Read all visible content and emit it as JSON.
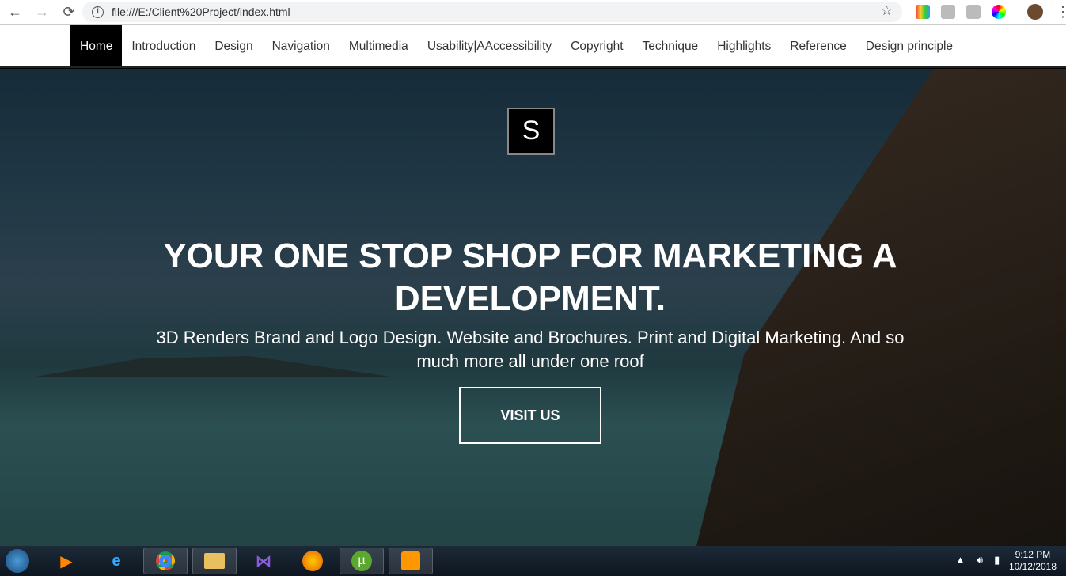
{
  "browser": {
    "url": "file:///E:/Client%20Project/index.html",
    "back": "←",
    "forward": "→",
    "reload": "⟳",
    "info": "i",
    "star": "☆",
    "menu": "⋮"
  },
  "nav": {
    "items": [
      {
        "label": "Home",
        "active": true
      },
      {
        "label": "Introduction"
      },
      {
        "label": "Design"
      },
      {
        "label": "Navigation"
      },
      {
        "label": "Multimedia"
      },
      {
        "label": "Usability|AAccessibility"
      },
      {
        "label": "Copyright"
      },
      {
        "label": "Technique"
      },
      {
        "label": "Highlights"
      },
      {
        "label": "Reference"
      },
      {
        "label": "Design principle"
      }
    ]
  },
  "hero": {
    "logo_letter": "S",
    "headline": "YOUR ONE STOP SHOP FOR MARKETING A DEVELOPMENT.",
    "subtitle": "3D Renders Brand and Logo Design. Website and Brochures. Print and Digital Marketing. And so much more all under one roof",
    "cta": "VISIT US"
  },
  "taskbar": {
    "time": "9:12 PM",
    "date": "10/12/2018"
  }
}
